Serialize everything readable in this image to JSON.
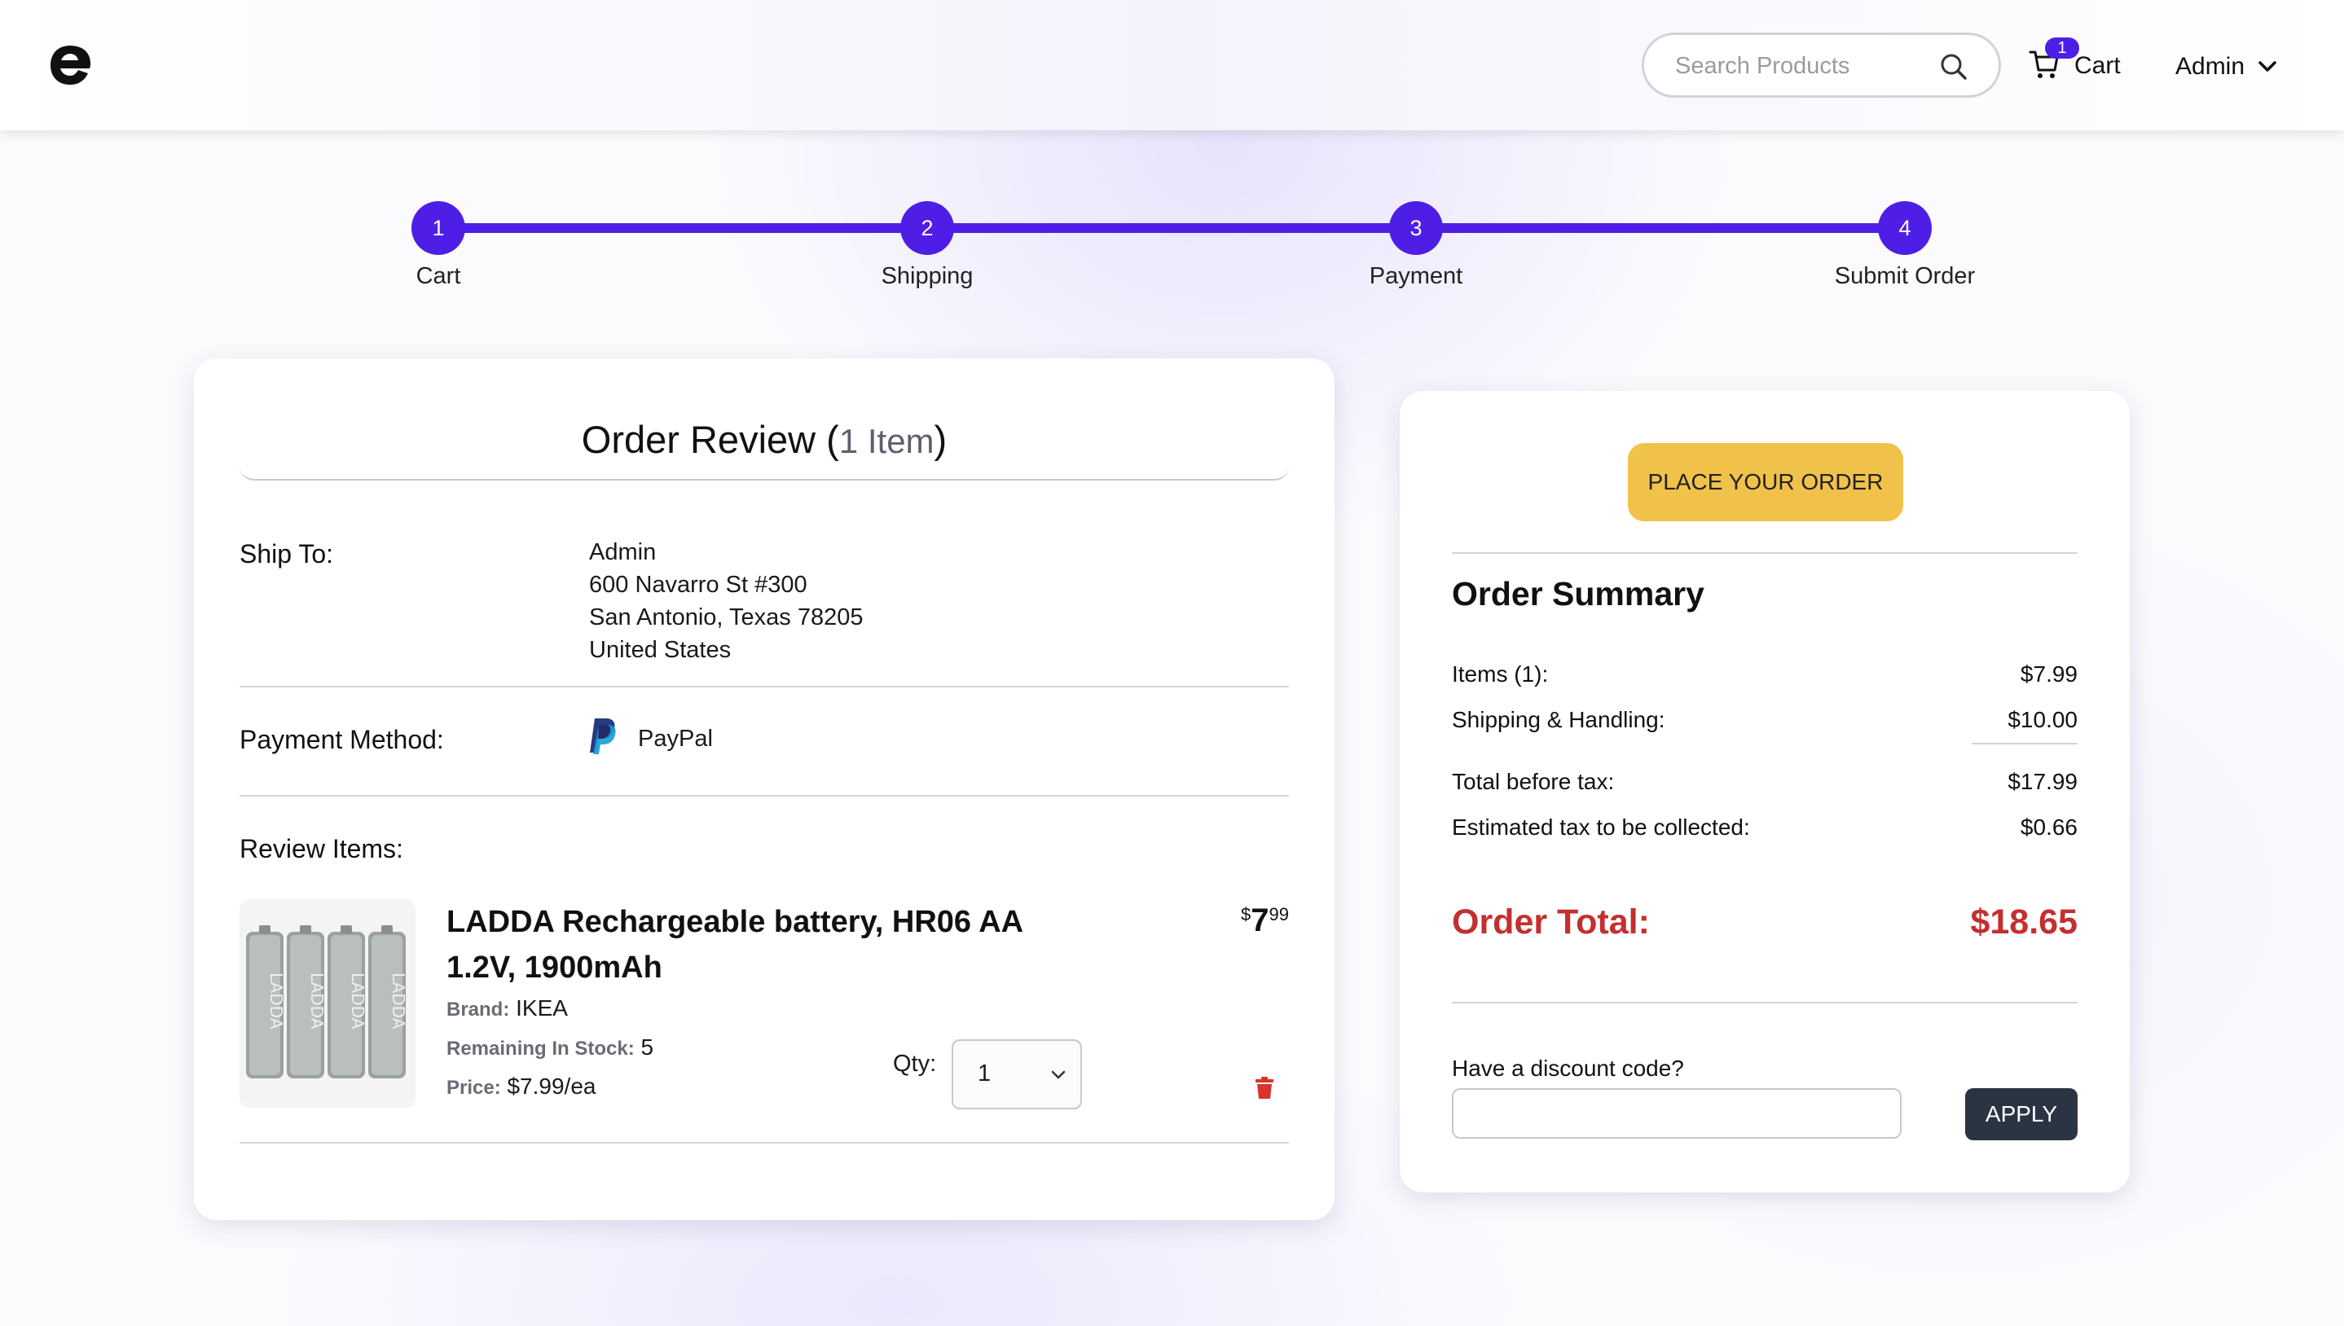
{
  "header": {
    "search_placeholder": "Search Products",
    "cart_count": "1",
    "cart_label": "Cart",
    "user_label": "Admin"
  },
  "stepper": {
    "steps": [
      {
        "number": "1",
        "label": "Cart"
      },
      {
        "number": "2",
        "label": "Shipping"
      },
      {
        "number": "3",
        "label": "Payment"
      },
      {
        "number": "4",
        "label": "Submit Order"
      }
    ],
    "color": "#4f1ee6"
  },
  "review": {
    "title": "Order Review",
    "paren_open": "(",
    "item_count": "1 Item",
    "paren_close": ")",
    "ship_to_label": "Ship To:",
    "address": {
      "name": "Admin",
      "line1": "600 Navarro St #300",
      "line2": "San Antonio, Texas 78205",
      "country": "United States"
    },
    "payment_label": "Payment Method:",
    "payment_method": "PayPal",
    "payment_icon": "paypal-icon",
    "items_label": "Review Items:",
    "item": {
      "name": "LADDA Rechargeable battery, HR06 AA 1.2V, 1900mAh",
      "brand_key": "Brand:",
      "brand": "IKEA",
      "stock_key": "Remaining In Stock:",
      "stock": "5",
      "price_key": "Price:",
      "price_each": "$7.99/ea",
      "price_symbol": "$",
      "price_whole": "7",
      "price_cents": "99",
      "qty_label": "Qty:",
      "qty_value": "1",
      "image_text": "LADDA"
    }
  },
  "summary": {
    "place_order": "PLACE YOUR ORDER",
    "title": "Order Summary",
    "rows": [
      {
        "label": "Items (1):",
        "value": "$7.99"
      },
      {
        "label": "Shipping & Handling:",
        "value": "$10.00"
      },
      {
        "label": "Total before tax:",
        "value": "$17.99"
      },
      {
        "label": "Estimated tax to be collected:",
        "value": "$0.66"
      }
    ],
    "total_label": "Order Total:",
    "total_value": "$18.65",
    "discount_label": "Have a discount code?",
    "apply_label": "APPLY",
    "accent_button": "#f1c24a",
    "total_color": "#c42f2f"
  }
}
